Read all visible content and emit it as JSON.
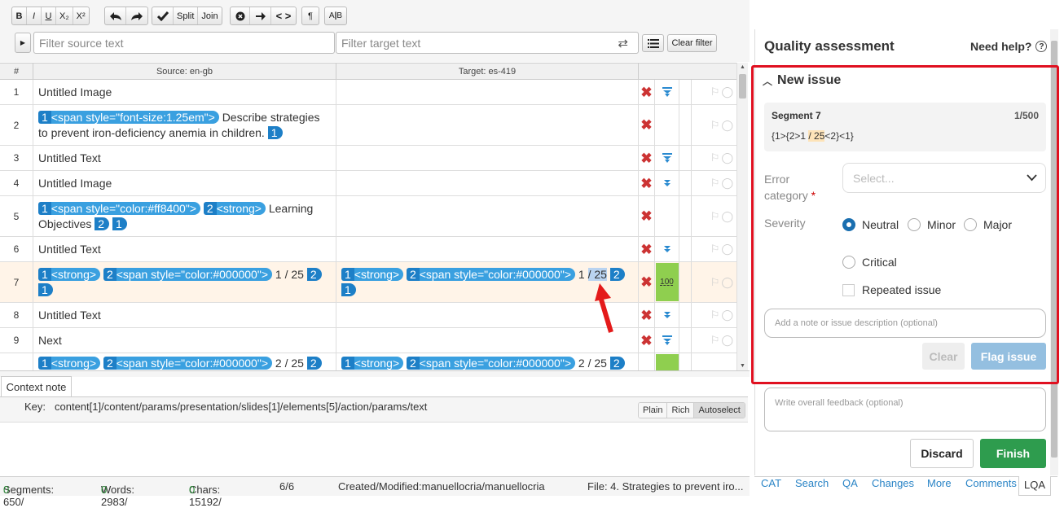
{
  "toolbar": {
    "bold": "B",
    "italic": "I",
    "underline": "U",
    "subscript": "X₂",
    "superscript": "X²",
    "split": "Split",
    "join": "Join",
    "pilcrow": "¶"
  },
  "filter": {
    "source_placeholder": "Filter source text",
    "target_placeholder": "Filter target text",
    "clear_label": "Clear filter"
  },
  "grid": {
    "col_num": "#",
    "col_source": "Source: en-gb",
    "col_target": "Target: es-419",
    "rows": [
      {
        "num": "1",
        "source": "Untitled Image"
      },
      {
        "num": "2",
        "tag1": "1",
        "tag1_text": "<span style=\"font-size:1.25em\">",
        "text": "Describe strategies to prevent iron-deficiency anemia in children.",
        "close1": "1"
      },
      {
        "num": "3",
        "source": "Untitled Text"
      },
      {
        "num": "4",
        "source": "Untitled Image"
      },
      {
        "num": "5",
        "tag1": "1",
        "tag1_text": "<span style=\"color:#ff8400\">",
        "tag2": "2",
        "tag2_text": "<strong>",
        "text": "Learning Objectives",
        "close2": "2",
        "close1": "1"
      },
      {
        "num": "6",
        "source": "Untitled Text"
      },
      {
        "num": "7",
        "tag1": "1",
        "tag1_text": "<strong>",
        "tag2": "2",
        "tag2_text": "<span style=\"color:#000000\">",
        "text": "1 / 25",
        "close2": "2",
        "close1": "1",
        "t_tag1": "1",
        "t_tag1_text": "<strong>",
        "t_tag2": "2",
        "t_tag2_text": "<span style=\"color:#000000\">",
        "t_text_a": "1",
        "t_text_b": "/ 25",
        "t_close2": "2",
        "t_close1": "1",
        "match": "100"
      },
      {
        "num": "8",
        "source": "Untitled Text"
      },
      {
        "num": "9",
        "source": "Next"
      },
      {
        "num": "10",
        "tag1": "1",
        "tag1_text": "<strong>",
        "tag2": "2",
        "tag2_text": "<span style=\"color:#000000\">",
        "text": "2 / 25",
        "close2": "2",
        "t_tag1": "1",
        "t_tag1_text": "<strong>",
        "t_tag2": "2",
        "t_tag2_text": "<span style=\"color:#000000\">",
        "t_text": "2 / 25",
        "t_close2": "2"
      }
    ]
  },
  "context": {
    "tab": "Context note",
    "key_label": "Key:",
    "key_value": "content[1]/content/params/presentation/slides[1]/elements[5]/action/params/text",
    "modes": [
      "Plain",
      "Rich",
      "Autoselect"
    ]
  },
  "status": {
    "segments_label": "Segments: 650/",
    "segments_zero": "0",
    "words_label": "Words: 2983/",
    "words_zero": "0",
    "chars_label": "Chars: 15192/",
    "chars_zero": "0",
    "pages": "6/6",
    "created": "Created/Modified:manuellocria/manuellocria",
    "file": "File: 4. Strategies to prevent iro..."
  },
  "qa": {
    "title": "Quality assessment",
    "help": "Need help?",
    "new_issue": "New issue",
    "segment_label": "Segment 7",
    "counter": "1/500",
    "segment_text_a": "{1>{2>1 ",
    "segment_text_b": "/ 25",
    "segment_text_c": "<2}<1}",
    "error_category_label": "Error category",
    "required_mark": "*",
    "select_placeholder": "Select...",
    "severity_label": "Severity",
    "severity_options": [
      "Neutral",
      "Minor",
      "Major",
      "Critical"
    ],
    "repeated_label": "Repeated issue",
    "note_placeholder": "Add a note or issue description (optional)",
    "clear_btn": "Clear",
    "flag_btn": "Flag issue",
    "feedback_placeholder": "Write overall feedback (optional)",
    "discard_btn": "Discard",
    "finish_btn": "Finish"
  },
  "right_tabs": [
    "CAT",
    "Search",
    "QA",
    "Changes",
    "More",
    "Comments",
    "LQA"
  ],
  "colors": {
    "accent": "#1d7fc7",
    "tag": "#3aa0e0",
    "highlight_box": "#e01020",
    "finish": "#2e9c4e",
    "match": "#8fcf4f"
  }
}
